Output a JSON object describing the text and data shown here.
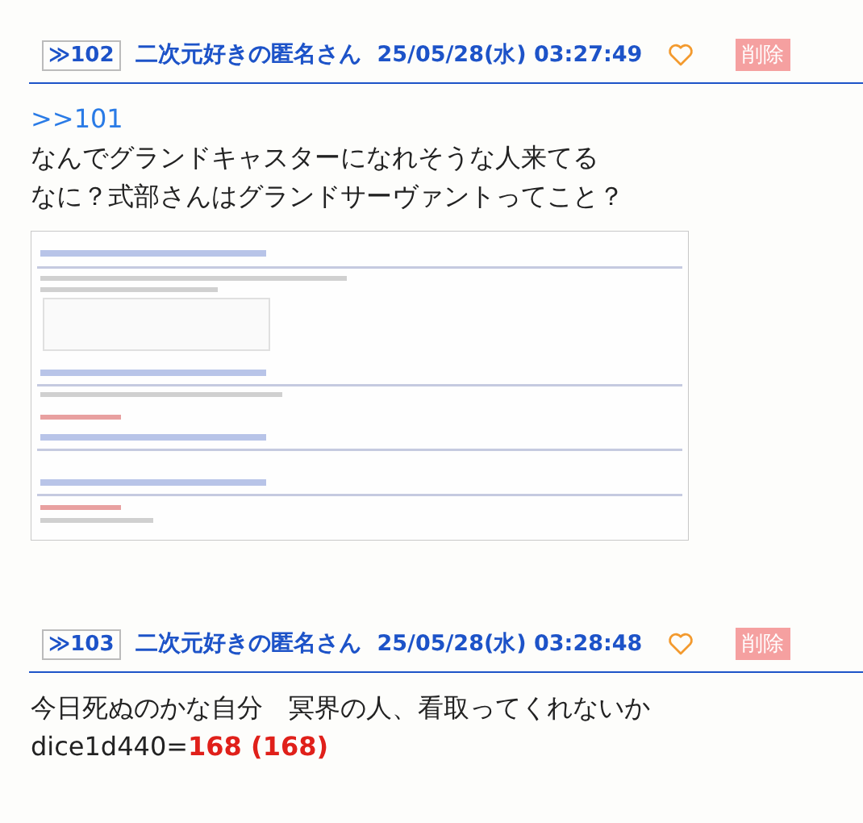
{
  "posts": [
    {
      "number": "≫102",
      "name": "二次元好きの匿名さん",
      "date": "25/05/28(水) 03:27:49",
      "delete_label": "削除",
      "body": [
        {
          "kind": "reply_link",
          "text": ">>101"
        },
        {
          "kind": "text",
          "text": "なんでグランドキャスターになれそうな人来てる"
        },
        {
          "kind": "text",
          "text": "なに？式部さんはグランドサーヴァントってこと？"
        }
      ]
    },
    {
      "number": "≫103",
      "name": "二次元好きの匿名さん",
      "date": "25/05/28(水) 03:28:48",
      "delete_label": "削除",
      "body": [
        {
          "kind": "text",
          "text": "今日死ぬのかな自分　冥界の人、看取ってくれないか"
        },
        {
          "kind": "dice",
          "text": "dice1d440=",
          "result": "168 (168)"
        }
      ]
    }
  ]
}
